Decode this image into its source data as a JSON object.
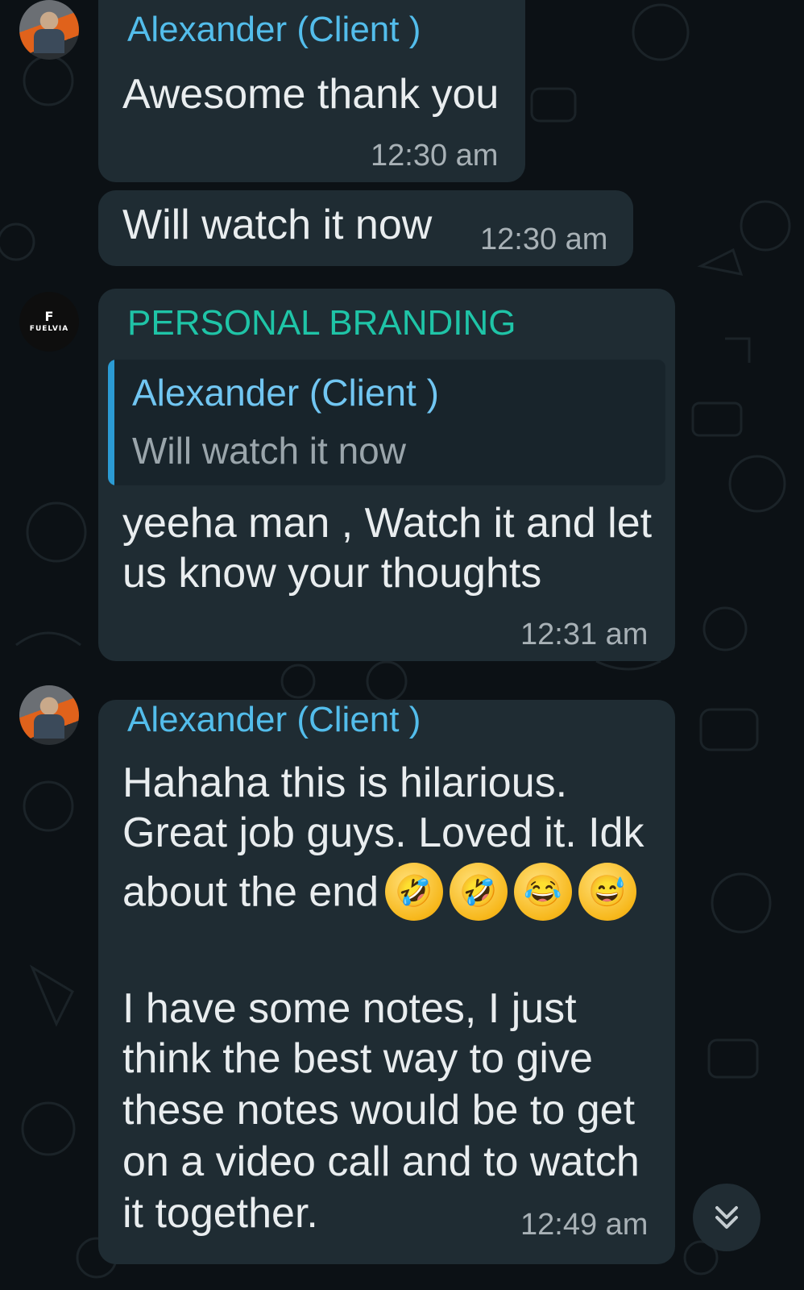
{
  "messages": [
    {
      "sender": "Alexander (Client )",
      "text": "Awesome thank you",
      "time": "12:30 am"
    },
    {
      "text": "Will watch it now",
      "time": "12:30 am"
    },
    {
      "sender": "PERSONAL BRANDING",
      "avatar_label": "FUELVIA",
      "reply_to": {
        "sender": "Alexander (Client )",
        "text": "Will watch it now"
      },
      "lines": [
        "yeeha man , Watch it and let",
        "us know your thoughts"
      ],
      "time": "12:31 am"
    },
    {
      "sender": "Alexander (Client )",
      "lines": [
        "Hahaha this is hilarious.",
        "Great job guys. Loved it. Idk",
        "about the end",
        "",
        "I have some notes, I just",
        "think the best way to give",
        "these notes would be to get",
        "on a video call and to watch",
        "it together."
      ],
      "emojis": [
        "rolling-on-floor-laughing-icon",
        "rolling-on-floor-laughing-icon",
        "face-with-tears-of-joy-icon",
        "grinning-squinting-sweat-icon"
      ],
      "time": "12:49 am"
    }
  ],
  "colors": {
    "bubble": "#1f2c33",
    "sender_blue": "#53bdeb",
    "sender_teal": "#1fc4a7",
    "quote_bar": "#2b9bd4"
  }
}
